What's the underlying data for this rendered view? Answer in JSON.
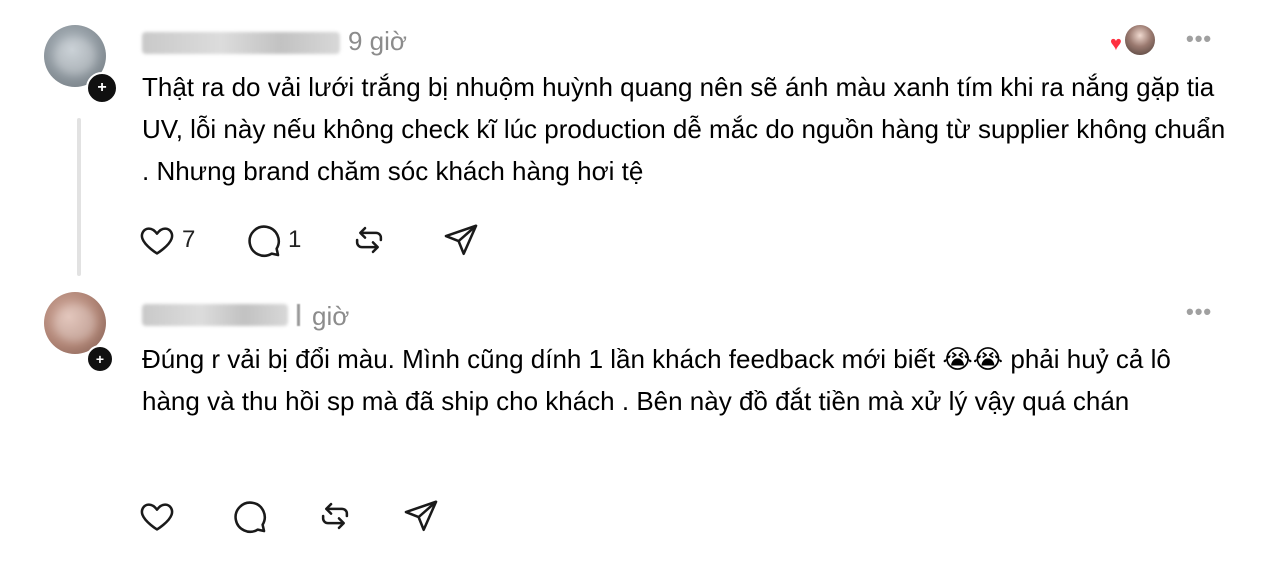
{
  "posts": [
    {
      "username": "jamgfumguyen",
      "time": "9 giờ",
      "text": "Thật ra do vải lưới trắng bị nhuộm huỳnh quang nên sẽ ánh màu xanh tím khi ra nắng gặp tia UV, lỗi này nếu không check kĩ lúc production dễ mắc do nguồn hàng từ supplier không chuẩn . Nhưng brand chăm sóc khách hàng hơi tệ",
      "likes": "7",
      "replies": "1",
      "liked_by_author": true,
      "more_label": "•••",
      "icons": [
        "heart-icon",
        "reply-icon",
        "repost-icon",
        "share-icon"
      ]
    },
    {
      "username": "bonbon",
      "time": "giờ",
      "text": "Đúng r vải bị đổi màu. Mình cũng dính 1 lần khách feedback mới biết 😭😭 phải huỷ cả lô hàng và thu hồi sp mà đã ship cho khách . Bên này đồ đắt tiền mà xử lý vậy quá chán",
      "likes": "",
      "replies": "",
      "more_label": "•••",
      "icons": [
        "heart-icon",
        "reply-icon",
        "repost-icon",
        "share-icon"
      ]
    }
  ],
  "colors": {
    "text": "#000000",
    "muted": "#8c8c8c",
    "heart": "#ff3040",
    "thread_line": "#e2e2e2"
  }
}
